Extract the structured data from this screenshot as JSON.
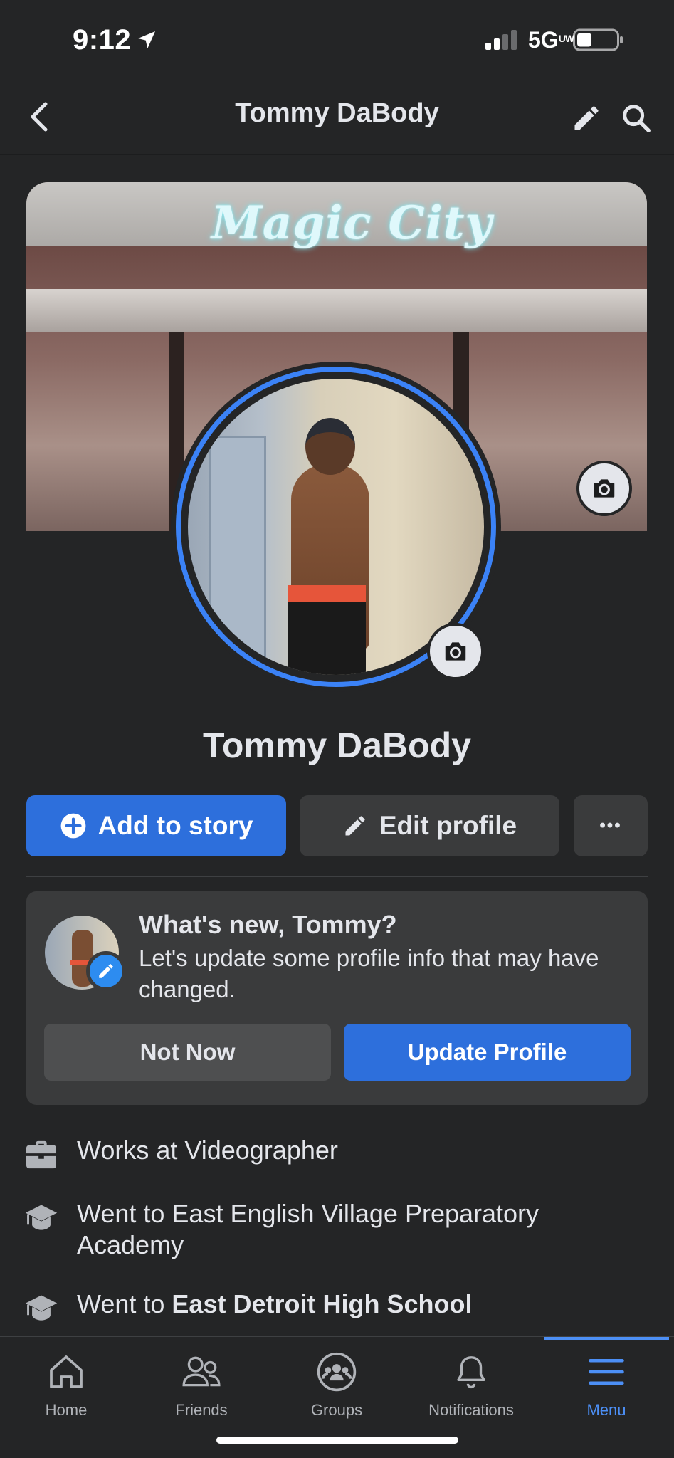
{
  "status_bar": {
    "time": "9:12",
    "network": "5G",
    "network_suffix": "UW"
  },
  "header": {
    "title": "Tommy DaBody"
  },
  "cover": {
    "sign_text": "Magic City"
  },
  "profile": {
    "name": "Tommy DaBody"
  },
  "actions": {
    "add_story": "Add to story",
    "edit_profile": "Edit profile",
    "more": "•••"
  },
  "whats_new": {
    "title": "What's new, Tommy?",
    "text": "Let's update some profile info that may have changed.",
    "not_now": "Not Now",
    "update": "Update Profile"
  },
  "details": [
    {
      "icon": "briefcase-icon",
      "prefix": "Works at ",
      "value": "Videographer"
    },
    {
      "icon": "graduation-cap-icon",
      "prefix": "Went to ",
      "value": "East English Village Preparatory Academy"
    },
    {
      "icon": "graduation-cap-icon",
      "prefix": "Went to ",
      "value": "East Detroit High School"
    }
  ],
  "nav": {
    "home": "Home",
    "friends": "Friends",
    "groups": "Groups",
    "notifications": "Notifications",
    "menu": "Menu",
    "active": "menu"
  },
  "colors": {
    "background": "#242526",
    "primary_button": "#2d6fdc",
    "secondary_button": "#3a3b3c",
    "active_nav": "#4c8ff5"
  }
}
